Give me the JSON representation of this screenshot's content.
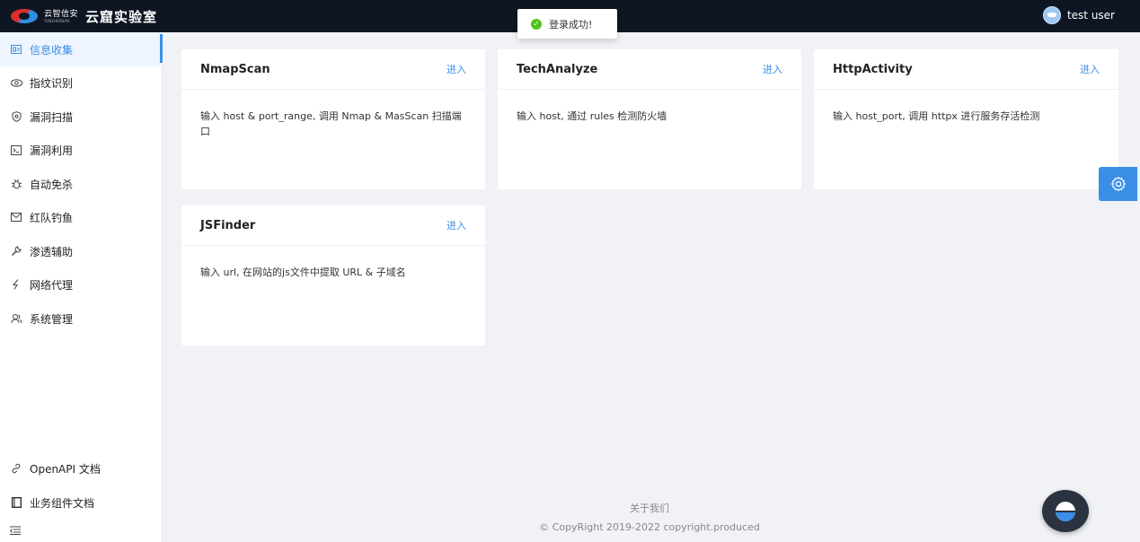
{
  "app": {
    "logo_cn": "云智信安",
    "logo_en": "YUNZHIXINAN",
    "brand": "云窟实验室",
    "user": "test user"
  },
  "toast": {
    "message": "登录成功!",
    "icon": "check-circle-icon"
  },
  "sidebar": {
    "items": [
      {
        "label": "信息收集",
        "icon": "id-card-icon"
      },
      {
        "label": "指纹识别",
        "icon": "eye-icon"
      },
      {
        "label": "漏洞扫描",
        "icon": "shield-icon"
      },
      {
        "label": "漏洞利用",
        "icon": "terminal-icon"
      },
      {
        "label": "自动免杀",
        "icon": "bug-icon"
      },
      {
        "label": "红队钓鱼",
        "icon": "mail-icon"
      },
      {
        "label": "渗透辅助",
        "icon": "wrench-icon"
      },
      {
        "label": "网络代理",
        "icon": "lightning-icon"
      },
      {
        "label": "系统管理",
        "icon": "users-icon"
      }
    ],
    "bottom": [
      {
        "label": "OpenAPI 文档",
        "icon": "link-icon"
      },
      {
        "label": "业务组件文档",
        "icon": "book-icon"
      }
    ],
    "active_color": "#3a8ee6"
  },
  "cards": [
    {
      "title": "NmapScan",
      "enter": "进入",
      "desc": "输入 host & port_range, 调用 Nmap & MasScan 扫描端口"
    },
    {
      "title": "TechAnalyze",
      "enter": "进入",
      "desc": "输入 host, 通过 rules 检测防火墙"
    },
    {
      "title": "HttpActivity",
      "enter": "进入",
      "desc": "输入 host_port, 调用 httpx 进行服务存活检测"
    },
    {
      "title": "JSFinder",
      "enter": "进入",
      "desc": "输入 url, 在网站的js文件中提取 URL & 子域名"
    }
  ],
  "footer": {
    "about": "关于我们",
    "copyright": "© CopyRight 2019-2022 copyright.produced"
  }
}
